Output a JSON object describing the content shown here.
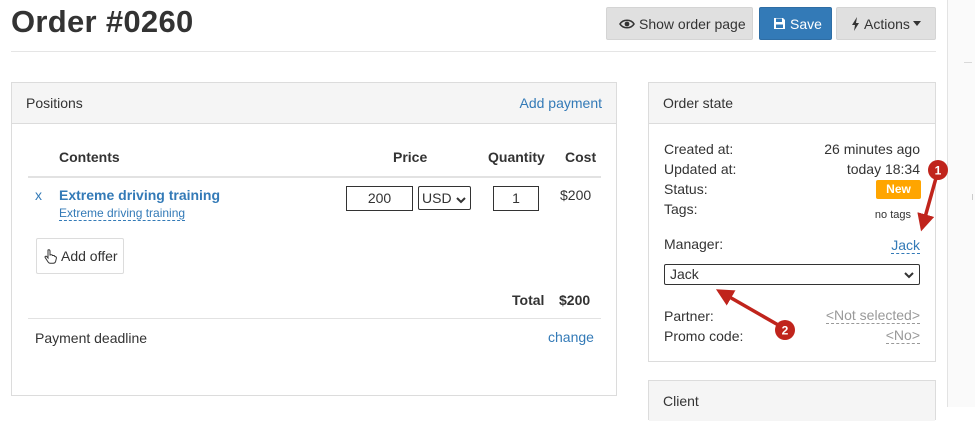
{
  "page": {
    "title": "Order #0260"
  },
  "toolbar": {
    "show_order_page": "Show order page",
    "save": "Save",
    "actions": "Actions"
  },
  "positions": {
    "title": "Positions",
    "add_payment": "Add payment",
    "columns": {
      "contents": "Contents",
      "price": "Price",
      "quantity": "Quantity",
      "cost": "Cost"
    },
    "items": [
      {
        "remove": "x",
        "name": "Extreme driving training",
        "offer": "Extreme driving training",
        "price": "200",
        "currency": "USD",
        "quantity": "1",
        "cost": "$200"
      }
    ],
    "add_offer": "Add offer",
    "total_label": "Total",
    "total_value": "$200",
    "payment_deadline": "Payment deadline",
    "change": "change"
  },
  "order_state": {
    "title": "Order state",
    "created_label": "Created at:",
    "created_value": "26 minutes ago",
    "updated_label": "Updated at:",
    "updated_value": "today 18:34",
    "status_label": "Status:",
    "status_value": "New",
    "tags_label": "Tags:",
    "tags_value": "no tags",
    "manager_label": "Manager:",
    "manager_value": "Jack",
    "manager_select_value": "Jack",
    "partner_label": "Partner:",
    "partner_value": "<Not selected>",
    "promo_label": "Promo code:",
    "promo_value": "<No>"
  },
  "client": {
    "title": "Client"
  },
  "annotations": [
    {
      "label": "1",
      "color": "#c0241c"
    },
    {
      "label": "2",
      "color": "#c0241c"
    }
  ],
  "colors": {
    "link": "#337ab7",
    "primary": "#337ab7",
    "badge_new": "#ffa500",
    "annotation": "#c0241c"
  }
}
